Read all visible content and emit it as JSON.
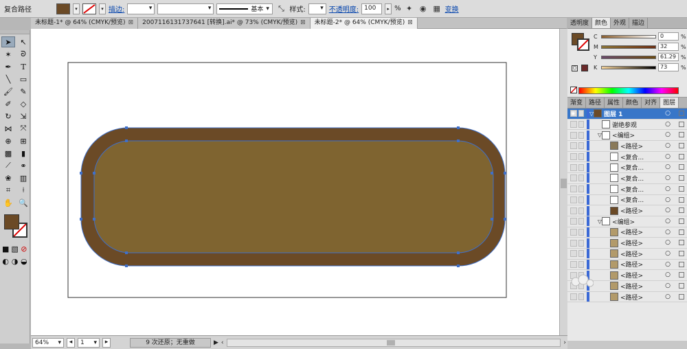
{
  "control_bar": {
    "object_type": "复合路径",
    "stroke_label": "描边:",
    "stroke_weight": "",
    "profile_label": "基本",
    "style_label": "样式:",
    "opacity_label": "不透明度:",
    "opacity_value": "100",
    "opacity_unit": "%",
    "transform_label": "变换",
    "fill_color": "#6b4a26"
  },
  "doc_tabs": [
    {
      "label": "未标题-1* @ 64% (CMYK/预览)",
      "active": false
    },
    {
      "label": "2007116131737641 [转换].ai* @ 73% (CMYK/预览)",
      "active": false
    },
    {
      "label": "未标题-2* @ 64% (CMYK/预览)",
      "active": true
    }
  ],
  "tab_close": "⊠",
  "toolbar": {
    "tools": [
      "selection",
      "direct-selection",
      "magic-wand",
      "lasso",
      "pen",
      "type",
      "line",
      "rectangle",
      "paintbrush",
      "pencil",
      "blob-brush",
      "eraser",
      "rotate",
      "scale",
      "width",
      "free-transform",
      "shape-builder",
      "perspective-grid",
      "mesh",
      "gradient",
      "eyedropper",
      "blend",
      "symbol-sprayer",
      "column-graph",
      "artboard",
      "slice",
      "hand",
      "zoom"
    ],
    "fill_color": "#6b4a26"
  },
  "artwork": {
    "outer_color": "#6b4a26",
    "inner_color": "#7f6430",
    "path_color": "#3f6fc8"
  },
  "status": {
    "zoom": "64%",
    "page": "1",
    "message": "9 次还原；无重做"
  },
  "panel": {
    "top_tabs": [
      "透明度",
      "颜色",
      "外观",
      "描边"
    ],
    "color": {
      "channels": [
        {
          "label": "C",
          "value": "0",
          "unit": "%",
          "gradient": "linear-gradient(90deg,#8a5e2e,#ffffff)"
        },
        {
          "label": "M",
          "value": "32",
          "unit": "%",
          "gradient": "linear-gradient(90deg,#8a7234,#6b2c10)"
        },
        {
          "label": "Y",
          "value": "61.29",
          "unit": "%",
          "gradient": "linear-gradient(90deg,#6b4a6a,#6b4a10)"
        },
        {
          "label": "K",
          "value": "73",
          "unit": "%",
          "gradient": "linear-gradient(90deg,#f5d39a,#000000)"
        }
      ]
    },
    "lower_tabs": [
      "渐变",
      "路径",
      "属性",
      "颜色",
      "对齐",
      "图层"
    ],
    "layers": [
      {
        "name": "图层 1",
        "indent": 0,
        "thumb": "#6b4a26",
        "top": true
      },
      {
        "name": "谢绝参观",
        "indent": 1
      },
      {
        "name": "<编组>",
        "indent": 1,
        "expanded": true
      },
      {
        "name": "<路径>",
        "indent": 2,
        "thumb": "#8a7a5a"
      },
      {
        "name": "<复合...",
        "indent": 2
      },
      {
        "name": "<复合...",
        "indent": 2
      },
      {
        "name": "<复合...",
        "indent": 2
      },
      {
        "name": "<复合...",
        "indent": 2
      },
      {
        "name": "<复合...",
        "indent": 2
      },
      {
        "name": "<路径>",
        "indent": 2,
        "thumb": "#6b4a26"
      },
      {
        "name": "<编组>",
        "indent": 1,
        "expanded": true
      },
      {
        "name": "<路径>",
        "indent": 2,
        "thumb": "#b29a6a"
      },
      {
        "name": "<路径>",
        "indent": 2,
        "thumb": "#b29a6a"
      },
      {
        "name": "<路径>",
        "indent": 2,
        "thumb": "#b29a6a"
      },
      {
        "name": "<路径>",
        "indent": 2,
        "thumb": "#b29a6a"
      },
      {
        "name": "<路径>",
        "indent": 2,
        "thumb": "#b29a6a"
      },
      {
        "name": "<路径>",
        "indent": 2,
        "thumb": "#b29a6a"
      },
      {
        "name": "<路径>",
        "indent": 2,
        "thumb": "#b29a6a"
      }
    ]
  }
}
